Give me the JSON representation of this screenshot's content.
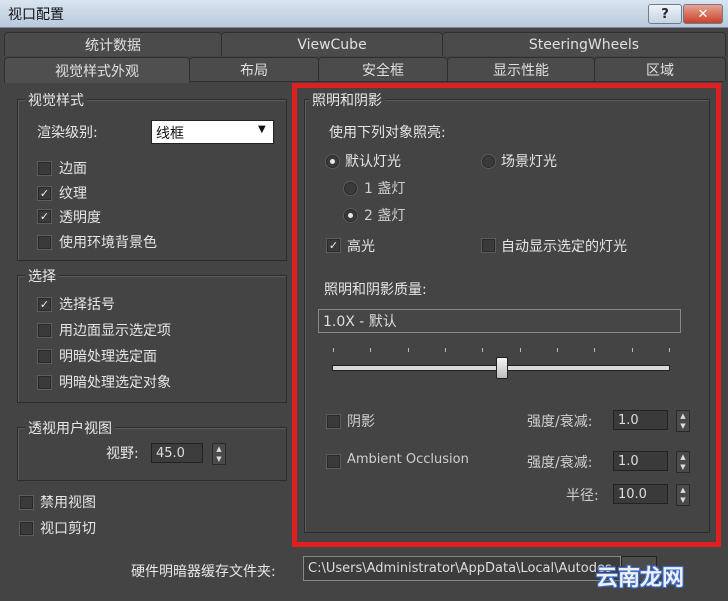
{
  "window": {
    "title": "视口配置",
    "help_label": "?",
    "close_label": "✕"
  },
  "tabs_top": [
    "统计数据",
    "ViewCube",
    "SteeringWheels"
  ],
  "tabs_bottom": [
    "视觉样式外观",
    "布局",
    "安全框",
    "显示性能",
    "区域"
  ],
  "visual_style": {
    "title": "视觉样式",
    "render_level_label": "渲染级别:",
    "render_level_value": "线框",
    "options": [
      {
        "label": "边面",
        "checked": false
      },
      {
        "label": "纹理",
        "checked": true
      },
      {
        "label": "透明度",
        "checked": true
      },
      {
        "label": "使用环境背景色",
        "checked": false
      }
    ]
  },
  "selection": {
    "title": "选择",
    "options": [
      {
        "label": "选择括号",
        "checked": true
      },
      {
        "label": "用边面显示选定项",
        "checked": false
      },
      {
        "label": "明暗处理选定面",
        "checked": false
      },
      {
        "label": "明暗处理选定对象",
        "checked": false
      }
    ]
  },
  "perspective": {
    "title": "透视用户视图",
    "fov_label": "视野:",
    "fov_value": "45.0"
  },
  "misc": {
    "disable_view": "禁用视图",
    "viewport_clip": "视口剪切"
  },
  "lighting": {
    "title": "照明和阴影",
    "use_lights_label": "使用下列对象照亮:",
    "default_lights": "默认灯光",
    "scene_lights": "场景灯光",
    "one_light": "1 盏灯",
    "two_lights": "2 盏灯",
    "highlights": "高光",
    "auto_display": "自动显示选定的灯光",
    "quality_label": "照明和阴影质量:",
    "quality_value": "1.0X - 默认",
    "slider_position": 0.5,
    "shadow_label": "阴影",
    "ao_label": "Ambient Occlusion",
    "intensity_label": "强度/衰减:",
    "shadow_intensity": "1.0",
    "ao_intensity": "1.0",
    "radius_label": "半径:",
    "radius_value": "10.0"
  },
  "cache": {
    "label": "硬件明暗器缓存文件夹:",
    "path": "C:\\Users\\Administrator\\AppData\\Local\\Autodes"
  },
  "watermark": "云南龙网",
  "colors": {
    "highlight": "#e02020",
    "background": "#444444"
  }
}
